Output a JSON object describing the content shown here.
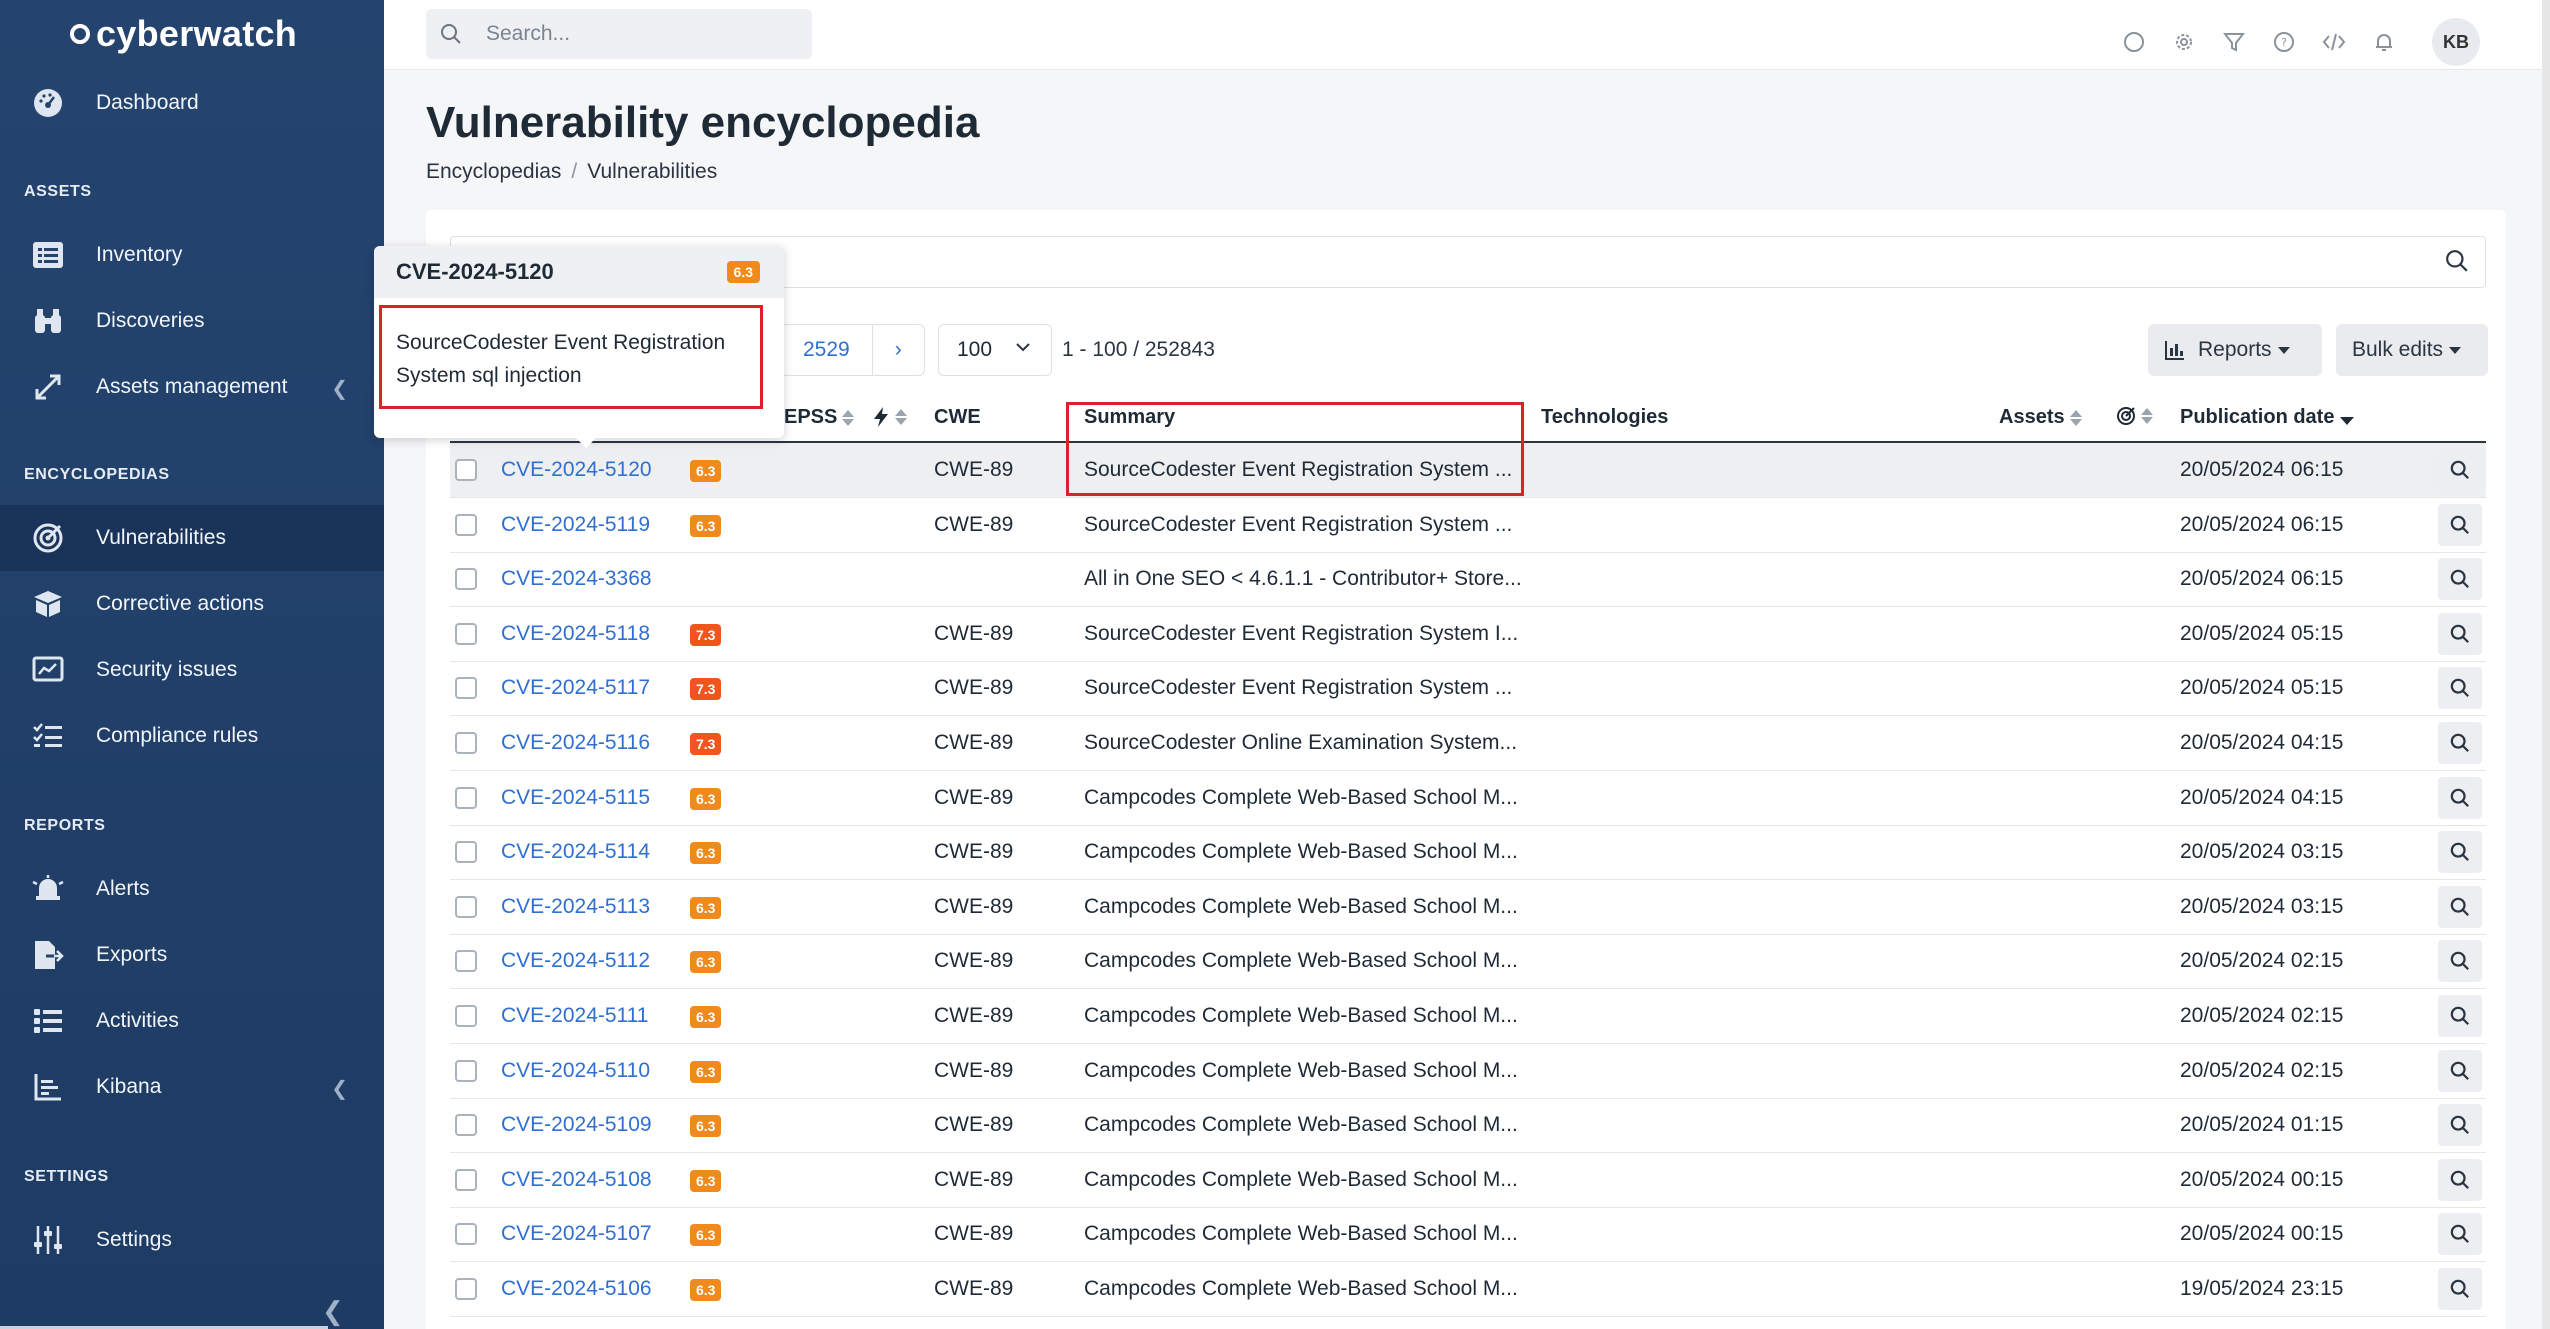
{
  "app": {
    "brand": "cyberwatch"
  },
  "sidebar": {
    "top": {
      "label": "Dashboard"
    },
    "sections": {
      "assets": "ASSETS",
      "encyclopedias": "ENCYCLOPEDIAS",
      "reports": "REPORTS",
      "settings": "SETTINGS"
    },
    "items": {
      "inventory": "Inventory",
      "discoveries": "Discoveries",
      "assets_management": "Assets management",
      "vulnerabilities": "Vulnerabilities",
      "corrective_actions": "Corrective actions",
      "security_issues": "Security issues",
      "compliance_rules": "Compliance rules",
      "alerts": "Alerts",
      "exports": "Exports",
      "activities": "Activities",
      "kibana": "Kibana",
      "settings": "Settings"
    }
  },
  "topbar": {
    "search_placeholder": "Search...",
    "avatar": "KB"
  },
  "page": {
    "title": "Vulnerability encyclopedia",
    "breadcrumb": [
      "Encyclopedias",
      "Vulnerabilities"
    ]
  },
  "toolbar": {
    "last_page": "2529",
    "next": "›",
    "per_page": "100",
    "range": "1 - 100 / 252843",
    "reports": "Reports",
    "bulk_edits": "Bulk edits"
  },
  "table": {
    "headers": {
      "epss": "EPSS",
      "cwe": "CWE",
      "summary": "Summary",
      "technologies": "Technologies",
      "assets": "Assets",
      "publication_date": "Publication date"
    },
    "rows": [
      {
        "cve": "CVE-2024-5120",
        "score": "6.3",
        "cwe": "CWE-89",
        "summary": "SourceCodester Event Registration System ...",
        "date": "20/05/2024 06:15"
      },
      {
        "cve": "CVE-2024-5119",
        "score": "6.3",
        "cwe": "CWE-89",
        "summary": "SourceCodester Event Registration System ...",
        "date": "20/05/2024 06:15"
      },
      {
        "cve": "CVE-2024-3368",
        "score": "",
        "cwe": "",
        "summary": "All in One SEO < 4.6.1.1 - Contributor+ Store...",
        "date": "20/05/2024 06:15"
      },
      {
        "cve": "CVE-2024-5118",
        "score": "7.3",
        "cwe": "CWE-89",
        "summary": "SourceCodester Event Registration System I...",
        "date": "20/05/2024 05:15"
      },
      {
        "cve": "CVE-2024-5117",
        "score": "7.3",
        "cwe": "CWE-89",
        "summary": "SourceCodester Event Registration System ...",
        "date": "20/05/2024 05:15"
      },
      {
        "cve": "CVE-2024-5116",
        "score": "7.3",
        "cwe": "CWE-89",
        "summary": "SourceCodester Online Examination System...",
        "date": "20/05/2024 04:15"
      },
      {
        "cve": "CVE-2024-5115",
        "score": "6.3",
        "cwe": "CWE-89",
        "summary": "Campcodes Complete Web-Based School M...",
        "date": "20/05/2024 04:15"
      },
      {
        "cve": "CVE-2024-5114",
        "score": "6.3",
        "cwe": "CWE-89",
        "summary": "Campcodes Complete Web-Based School M...",
        "date": "20/05/2024 03:15"
      },
      {
        "cve": "CVE-2024-5113",
        "score": "6.3",
        "cwe": "CWE-89",
        "summary": "Campcodes Complete Web-Based School M...",
        "date": "20/05/2024 03:15"
      },
      {
        "cve": "CVE-2024-5112",
        "score": "6.3",
        "cwe": "CWE-89",
        "summary": "Campcodes Complete Web-Based School M...",
        "date": "20/05/2024 02:15"
      },
      {
        "cve": "CVE-2024-5111",
        "score": "6.3",
        "cwe": "CWE-89",
        "summary": "Campcodes Complete Web-Based School M...",
        "date": "20/05/2024 02:15"
      },
      {
        "cve": "CVE-2024-5110",
        "score": "6.3",
        "cwe": "CWE-89",
        "summary": "Campcodes Complete Web-Based School M...",
        "date": "20/05/2024 02:15"
      },
      {
        "cve": "CVE-2024-5109",
        "score": "6.3",
        "cwe": "CWE-89",
        "summary": "Campcodes Complete Web-Based School M...",
        "date": "20/05/2024 01:15"
      },
      {
        "cve": "CVE-2024-5108",
        "score": "6.3",
        "cwe": "CWE-89",
        "summary": "Campcodes Complete Web-Based School M...",
        "date": "20/05/2024 00:15"
      },
      {
        "cve": "CVE-2024-5107",
        "score": "6.3",
        "cwe": "CWE-89",
        "summary": "Campcodes Complete Web-Based School M...",
        "date": "20/05/2024 00:15"
      },
      {
        "cve": "CVE-2024-5106",
        "score": "6.3",
        "cwe": "CWE-89",
        "summary": "Campcodes Complete Web-Based School M...",
        "date": "19/05/2024 23:15"
      }
    ]
  },
  "tooltip": {
    "title": "CVE-2024-5120",
    "score": "6.3",
    "body": "SourceCodester Event Registration System sql injection"
  },
  "colors": {
    "score_medium": "#f08a1c",
    "score_high": "#f0551c",
    "link": "#2f6fd1",
    "highlight": "#d8232a"
  }
}
